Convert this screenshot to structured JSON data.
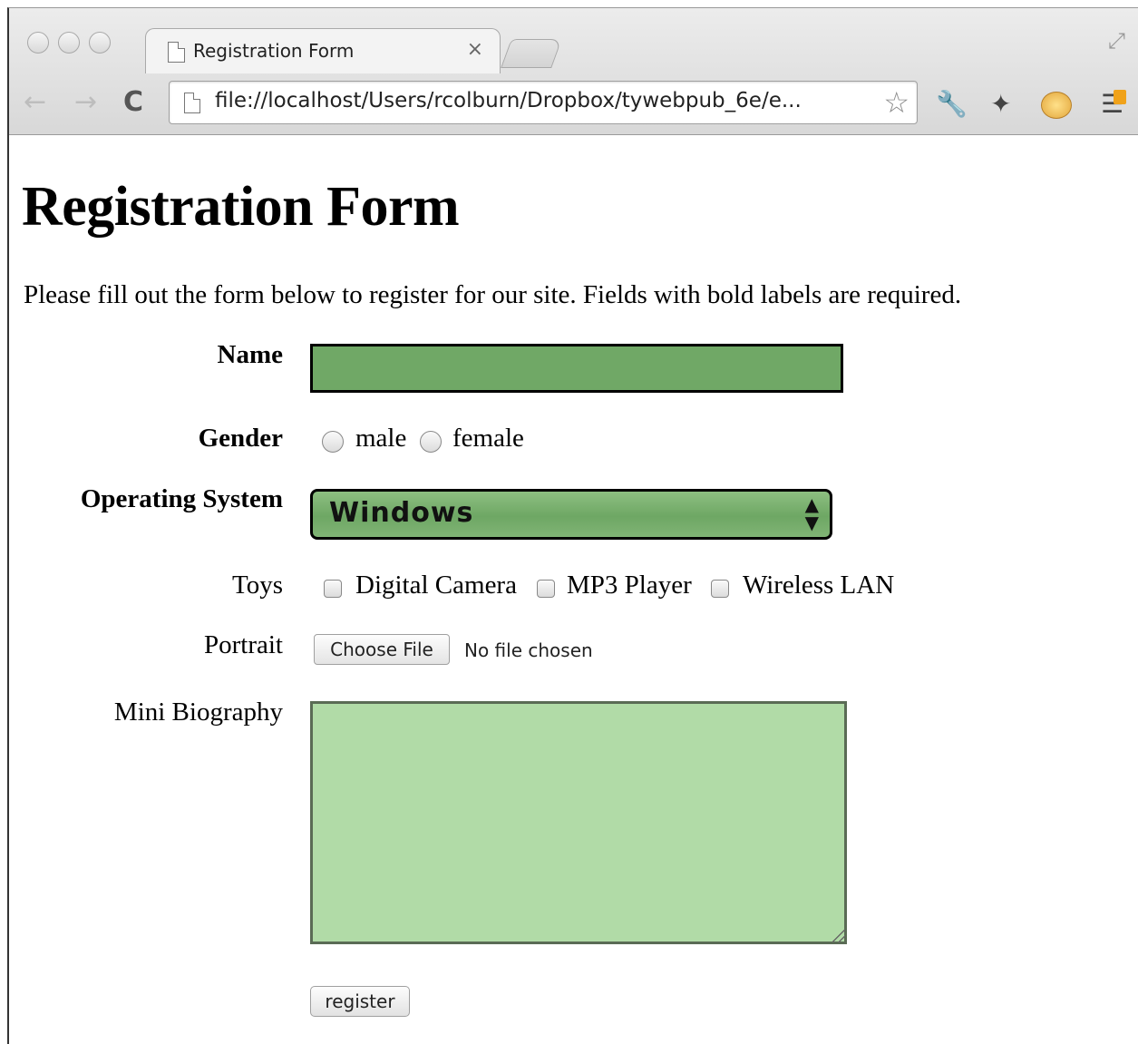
{
  "browser": {
    "tab_title": "Registration Form",
    "tab_close": "×",
    "url": "file://localhost/Users/rcolburn/Dropbox/tywebpub_6e/e...",
    "back_glyph": "←",
    "forward_glyph": "→",
    "reload_glyph": "C",
    "star_glyph": "☆",
    "wrench_glyph": "🔧",
    "pin_glyph": "✦",
    "menu_glyph": "☰",
    "fullscreen_glyph": "⤢"
  },
  "page": {
    "title": "Registration Form",
    "intro": "Please fill out the form below to register for our site. Fields with bold labels are required."
  },
  "form": {
    "name_label": "Name",
    "name_value": "",
    "gender_label": "Gender",
    "gender_options": [
      "male",
      "female"
    ],
    "os_label": "Operating System",
    "os_selected": "Windows",
    "toys_label": "Toys",
    "toys_options": [
      "Digital Camera",
      "MP3 Player",
      "Wireless LAN"
    ],
    "portrait_label": "Portrait",
    "file_button": "Choose File",
    "file_status": "No file chosen",
    "bio_label": "Mini Biography",
    "bio_value": "",
    "submit_label": "register"
  },
  "colors": {
    "name_field": "#70a866",
    "select_field": "#6ea764",
    "bio_field": "#b1dba7"
  },
  "icons": [
    "page-icon",
    "close-icon",
    "back-arrow-icon",
    "forward-arrow-icon",
    "reload-icon",
    "star-icon",
    "wrench-icon",
    "pin-icon",
    "extension-face-icon",
    "menu-icon",
    "fullscreen-icon",
    "select-arrows-icon"
  ]
}
